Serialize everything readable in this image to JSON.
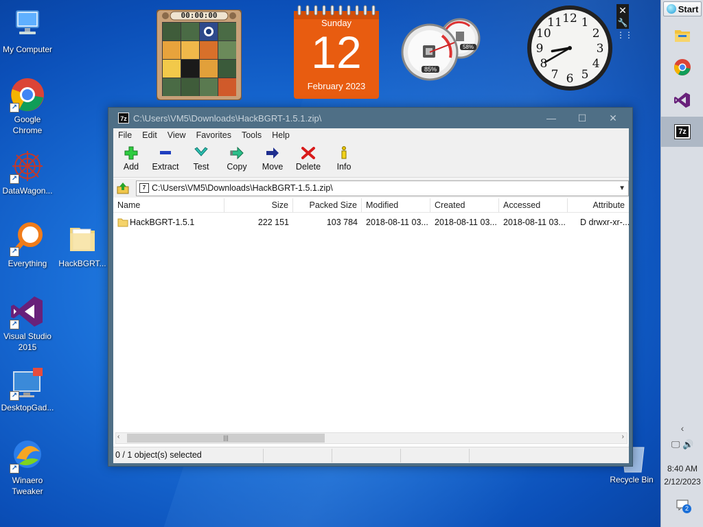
{
  "desktop": {
    "icons": [
      {
        "label": "My Computer"
      },
      {
        "label": "Google Chrome"
      },
      {
        "label": "DataWagon..."
      },
      {
        "label": "Everything"
      },
      {
        "label": "HackBGRT..."
      },
      {
        "label": "Visual Studio 2015"
      },
      {
        "label": "DesktopGad..."
      },
      {
        "label": "Winaero Tweaker"
      }
    ],
    "recycle_bin": "Recycle Bin"
  },
  "gadgets": {
    "puzzle": {
      "timer": "00:00:00"
    },
    "calendar": {
      "day_name": "Sunday",
      "day_number": "12",
      "month_year": "February 2023"
    },
    "meter": {
      "cpu": "85%",
      "memory": "58%"
    },
    "clock": {
      "hour": 8,
      "minute": 40,
      "numbers": [
        "12",
        "1",
        "2",
        "3",
        "4",
        "5",
        "6",
        "7",
        "8",
        "9",
        "10",
        "11"
      ]
    }
  },
  "taskbar": {
    "start_label": "Start",
    "time": "8:40 AM",
    "date": "2/12/2023",
    "notification_count": "2",
    "apps": [
      "file-explorer",
      "chrome",
      "visual-studio",
      "7zip"
    ]
  },
  "window": {
    "title": "C:\\Users\\VM5\\Downloads\\HackBGRT-1.5.1.zip\\",
    "title_icon": "7z",
    "menu": [
      "File",
      "Edit",
      "View",
      "Favorites",
      "Tools",
      "Help"
    ],
    "toolbar": {
      "add": "Add",
      "extract": "Extract",
      "test": "Test",
      "copy": "Copy",
      "move": "Move",
      "delete": "Delete",
      "info": "Info"
    },
    "address": "C:\\Users\\VM5\\Downloads\\HackBGRT-1.5.1.zip\\",
    "columns": {
      "name": "Name",
      "size": "Size",
      "packed": "Packed Size",
      "modified": "Modified",
      "created": "Created",
      "accessed": "Accessed",
      "attributes": "Attribute"
    },
    "rows": [
      {
        "name": "HackBGRT-1.5.1",
        "size": "222 151",
        "packed": "103 784",
        "modified": "2018-08-11 03...",
        "created": "2018-08-11 03...",
        "accessed": "2018-08-11 03...",
        "attributes": "D drwxr-xr-..."
      }
    ],
    "status": "0 / 1 object(s) selected",
    "colors": {
      "accent": "#4f6f86",
      "folder": "#f5d36a"
    }
  }
}
